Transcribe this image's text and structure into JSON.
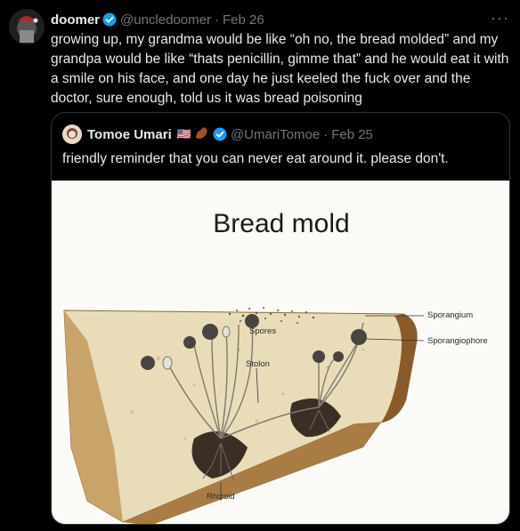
{
  "tweet": {
    "display_name": "doomer",
    "handle": "@uncledoomer",
    "separator": "·",
    "date": "Feb 26",
    "more_label": "···",
    "text": "growing up, my grandma would be like “oh no, the bread molded” and my grandpa would be like “thats penicillin, gimme that” and he would eat it with a smile on his face, and one day he just keeled the fuck over and the doctor, sure enough, told us it was bread poisoning"
  },
  "quote": {
    "display_name": "Tomoe Umari",
    "flags": "🇺🇸",
    "handle": "@UmariTomoe",
    "separator": "·",
    "date": "Feb 25",
    "text": "friendly reminder that you can never eat around it. please don't.",
    "media": {
      "title": "Bread mold",
      "labels": {
        "spores": "Spores",
        "sporangium": "Sporangium",
        "sporangiophore": "Sporangiophore",
        "stolon": "Stolon",
        "rhizoid": "Rhizoid"
      }
    }
  },
  "colors": {
    "background": "#000000",
    "text": "#e7e9ea",
    "muted": "#71767b",
    "verified": "#1d9bf0",
    "border": "#2f3336"
  }
}
